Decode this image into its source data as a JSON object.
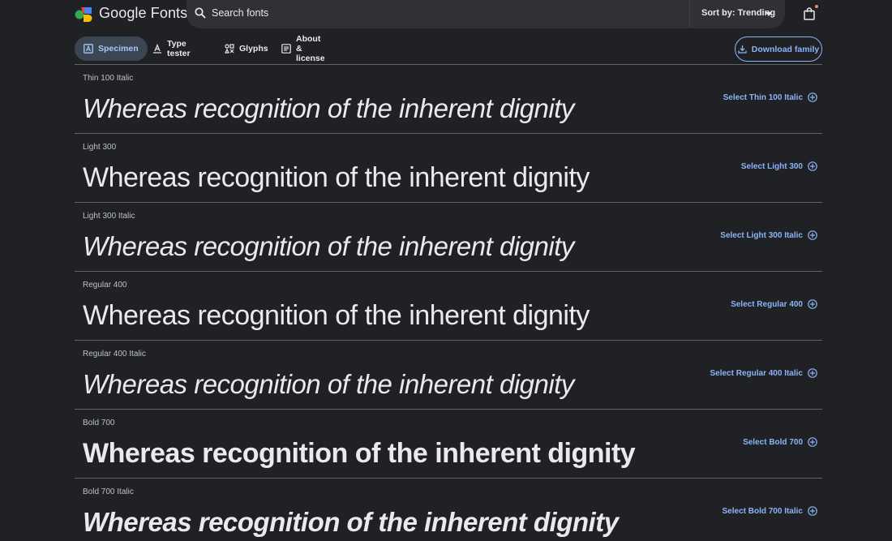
{
  "header": {
    "brand": "Google Fonts",
    "search_placeholder": "Search fonts",
    "sort_label": "Sort by: Trending"
  },
  "tabs": [
    {
      "label": "Specimen",
      "active": true
    },
    {
      "label": "Type tester",
      "active": false
    },
    {
      "label": "Glyphs",
      "active": false
    },
    {
      "label": "About & license",
      "active": false
    }
  ],
  "download_label": "Download family",
  "sample_text": "Whereas recognition of the inherent dignity",
  "styles": [
    {
      "label": "Thin 100 Italic",
      "select": "Select Thin 100 Italic"
    },
    {
      "label": "Light 300",
      "select": "Select Light 300"
    },
    {
      "label": "Light 300 Italic",
      "select": "Select Light 300 Italic"
    },
    {
      "label": "Regular 400",
      "select": "Select Regular 400"
    },
    {
      "label": "Regular 400 Italic",
      "select": "Select Regular 400 Italic"
    },
    {
      "label": "Bold 700",
      "select": "Select Bold 700"
    },
    {
      "label": "Bold 700 Italic",
      "select": "Select Bold 700 Italic"
    }
  ],
  "colors": {
    "background": "#202124",
    "accent": "#8ab4f8",
    "active_tab_bg": "#3c4652"
  },
  "icons": [
    "google-fonts-logo",
    "search-icon",
    "caret-down-icon",
    "shopping-bag-icon",
    "specimen-icon",
    "type-tester-icon",
    "glyphs-icon",
    "about-icon",
    "download-icon",
    "add-circle-icon"
  ]
}
